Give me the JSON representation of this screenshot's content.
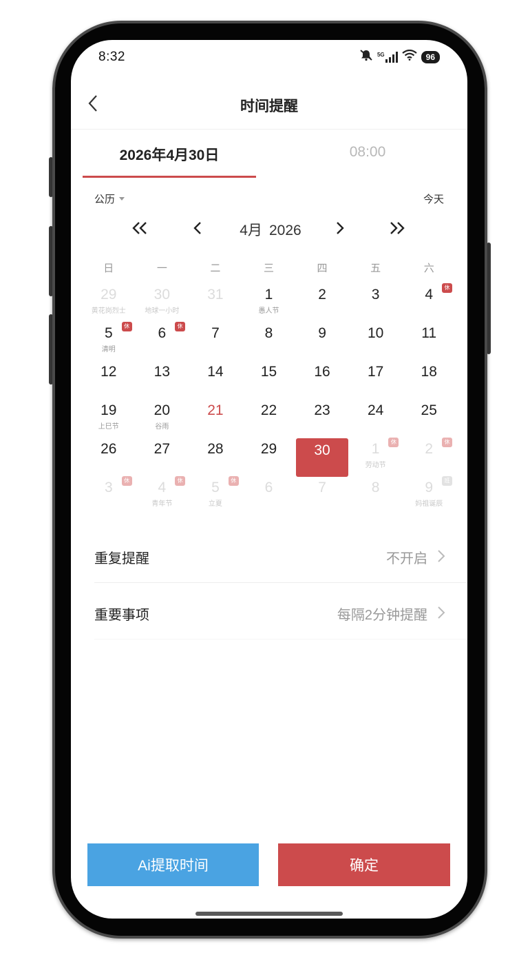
{
  "status_bar": {
    "time": "8:32",
    "network": "5G",
    "battery": "96"
  },
  "header": {
    "title": "时间提醒",
    "back_icon": "chevron-left-icon"
  },
  "tabs": {
    "date_label": "2026年4月30日",
    "time_label": "08:00"
  },
  "calendar": {
    "mode_label": "公历",
    "today_label": "今天",
    "month_label": "4月",
    "year_label": "2026",
    "weekdays": [
      "日",
      "一",
      "二",
      "三",
      "四",
      "五",
      "六"
    ],
    "holiday_badge": "休",
    "work_badge": "班",
    "days": [
      {
        "num": "29",
        "sub": "黄花岗烈士",
        "muted": true
      },
      {
        "num": "30",
        "sub": "地球一小时",
        "muted": true
      },
      {
        "num": "31",
        "sub": "",
        "muted": true
      },
      {
        "num": "1",
        "sub": "愚人节"
      },
      {
        "num": "2",
        "sub": ""
      },
      {
        "num": "3",
        "sub": ""
      },
      {
        "num": "4",
        "sub": "",
        "badge": "休"
      },
      {
        "num": "5",
        "sub": "清明",
        "badge": "休"
      },
      {
        "num": "6",
        "sub": "",
        "badge": "休"
      },
      {
        "num": "7",
        "sub": ""
      },
      {
        "num": "8",
        "sub": ""
      },
      {
        "num": "9",
        "sub": ""
      },
      {
        "num": "10",
        "sub": ""
      },
      {
        "num": "11",
        "sub": ""
      },
      {
        "num": "12",
        "sub": ""
      },
      {
        "num": "13",
        "sub": ""
      },
      {
        "num": "14",
        "sub": ""
      },
      {
        "num": "15",
        "sub": ""
      },
      {
        "num": "16",
        "sub": ""
      },
      {
        "num": "17",
        "sub": ""
      },
      {
        "num": "18",
        "sub": ""
      },
      {
        "num": "19",
        "sub": "上巳节"
      },
      {
        "num": "20",
        "sub": "谷雨"
      },
      {
        "num": "21",
        "sub": "",
        "red": true
      },
      {
        "num": "22",
        "sub": ""
      },
      {
        "num": "23",
        "sub": ""
      },
      {
        "num": "24",
        "sub": ""
      },
      {
        "num": "25",
        "sub": ""
      },
      {
        "num": "26",
        "sub": ""
      },
      {
        "num": "27",
        "sub": ""
      },
      {
        "num": "28",
        "sub": ""
      },
      {
        "num": "29",
        "sub": ""
      },
      {
        "num": "30",
        "sub": "",
        "selected": true
      },
      {
        "num": "1",
        "sub": "劳动节",
        "muted": true,
        "badge": "休"
      },
      {
        "num": "2",
        "sub": "",
        "muted": true,
        "badge": "休"
      },
      {
        "num": "3",
        "sub": "",
        "muted": true,
        "badge": "休"
      },
      {
        "num": "4",
        "sub": "青年节",
        "muted": true,
        "badge": "休"
      },
      {
        "num": "5",
        "sub": "立夏",
        "muted": true,
        "badge": "休"
      },
      {
        "num": "6",
        "sub": "",
        "muted": true
      },
      {
        "num": "7",
        "sub": "",
        "muted": true
      },
      {
        "num": "8",
        "sub": "",
        "muted": true
      },
      {
        "num": "9",
        "sub": "妈祖诞辰",
        "muted": true,
        "badge": "班",
        "work": true
      }
    ]
  },
  "settings": {
    "repeat": {
      "label": "重复提醒",
      "value": "不开启"
    },
    "important": {
      "label": "重要事项",
      "value": "每隔2分钟提醒"
    }
  },
  "buttons": {
    "ai_label": "Ai提取时间",
    "confirm_label": "确定"
  },
  "colors": {
    "accent_red": "#cc4b4c",
    "ai_blue": "#4aa3e2"
  }
}
